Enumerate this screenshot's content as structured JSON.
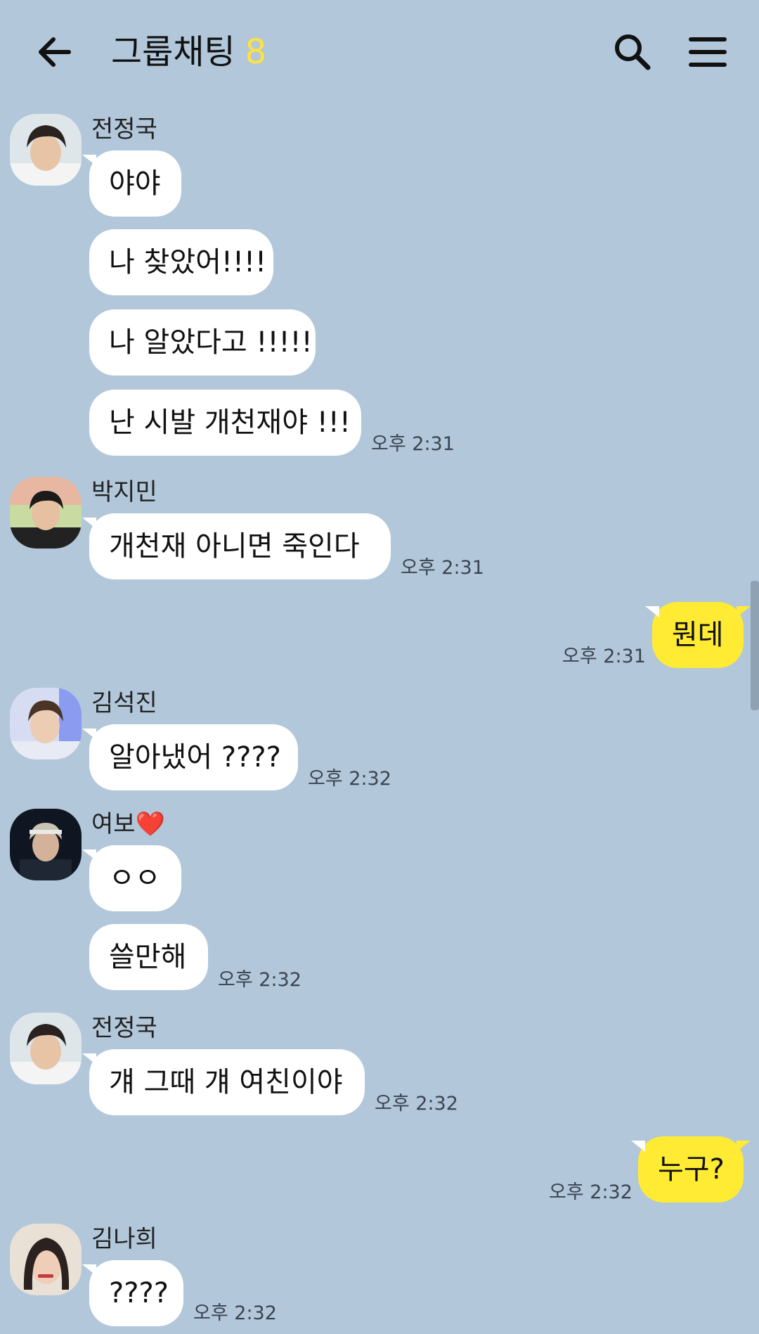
{
  "header": {
    "title": "그룹채팅",
    "member_count": "8",
    "back_icon": "arrow-left-icon",
    "search_icon": "search-icon",
    "menu_icon": "hamburger-menu-icon"
  },
  "colors": {
    "background": "#b2c7da",
    "other_bubble": "#ffffff",
    "my_bubble": "#ffeb33",
    "count": "#ffe23b"
  },
  "messages": [
    {
      "sender": "전정국",
      "texts": [
        "야야",
        "나 찾았어!!!!",
        "나 알았다고 !!!!!",
        "난 시발 개천재야 !!!"
      ],
      "time": "오후 2:31"
    },
    {
      "sender": "박지민",
      "texts": [
        "개천재 아니면 죽인다"
      ],
      "time": "오후 2:31"
    },
    {
      "mine": true,
      "texts": [
        "뭔데"
      ],
      "time": "오후 2:31"
    },
    {
      "sender": "김석진",
      "texts": [
        "알아냈어 ????"
      ],
      "time": "오후 2:32"
    },
    {
      "sender": "여보❤️",
      "texts": [
        "ㅇㅇ",
        "쓸만해"
      ],
      "time": "오후 2:32"
    },
    {
      "sender": "전정국",
      "texts": [
        "걔 그때 걔 여친이야"
      ],
      "time": "오후 2:32"
    },
    {
      "mine": true,
      "texts": [
        "누구?"
      ],
      "time": "오후 2:32"
    },
    {
      "sender": "김나희",
      "texts": [
        "????"
      ],
      "time": "오후 2:32"
    }
  ]
}
